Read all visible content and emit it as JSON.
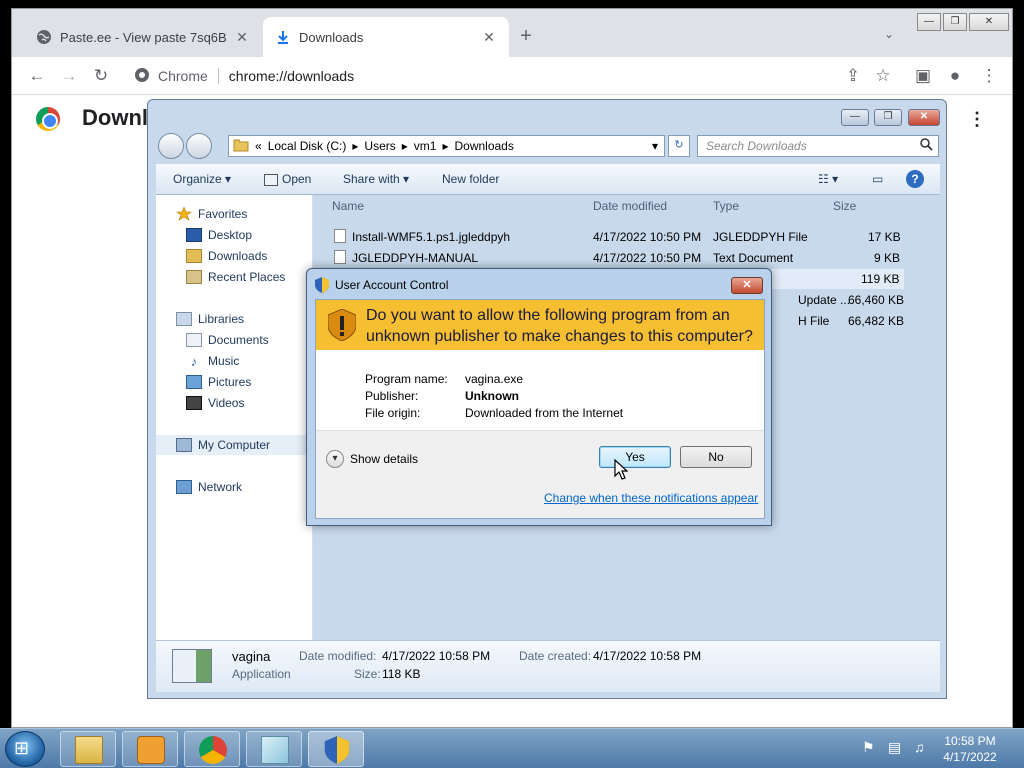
{
  "browser": {
    "tabs": [
      {
        "title": "Paste.ee - View paste 7sq6B",
        "close": "✕"
      },
      {
        "title": "Downloads",
        "close": "✕"
      }
    ],
    "new_tab": "+",
    "tab_search": "⌄",
    "window_controls": {
      "minimize": "—",
      "restore": "❐",
      "close": "✕"
    },
    "nav": {
      "back": "←",
      "forward": "→",
      "reload": "↻"
    },
    "omnibox": {
      "site_label": "Chrome",
      "url": "chrome://downloads"
    },
    "toolbar_icons": {
      "share": "⇪",
      "bookmark": "☆",
      "side_panel": "▣",
      "profile": "●",
      "menu": "⋮"
    },
    "page": {
      "title": "Downloads",
      "more": "⋮"
    }
  },
  "explorer": {
    "window_controls": {
      "minimize": "—",
      "restore": "❐",
      "close": "✕"
    },
    "address": {
      "prefix": "«",
      "parts": [
        "Local Disk (C:)",
        "Users",
        "vm1",
        "Downloads"
      ],
      "separator": "▸",
      "dropdown": "▾"
    },
    "refresh": "↻",
    "search_placeholder": "Search Downloads",
    "commands": {
      "organize": "Organize ▾",
      "open": "Open",
      "share_with": "Share with ▾",
      "new_folder": "New folder"
    },
    "nav_pane": {
      "favorites": "Favorites",
      "favorites_items": [
        "Desktop",
        "Downloads",
        "Recent Places"
      ],
      "libraries": "Libraries",
      "libraries_items": [
        "Documents",
        "Music",
        "Pictures",
        "Videos"
      ],
      "my_computer": "My Computer",
      "network": "Network"
    },
    "columns": [
      "Name",
      "Date modified",
      "Type",
      "Size"
    ],
    "files": [
      {
        "name": "Install-WMF5.1.ps1.jgleddpyh",
        "date": "4/17/2022 10:50 PM",
        "type": "JGLEDDPYH File",
        "size": "17 KB"
      },
      {
        "name": "JGLEDDPYH-MANUAL",
        "date": "4/17/2022 10:50 PM",
        "type": "Text Document",
        "size": "9 KB"
      },
      {
        "name": "",
        "date": "",
        "type": "",
        "size": "119 KB"
      },
      {
        "name": "",
        "date": "",
        "type": "Update ...",
        "size": "66,460 KB"
      },
      {
        "name": "",
        "date": "",
        "type": "H File",
        "size": "66,482 KB"
      }
    ],
    "details": {
      "name": "vagina",
      "kind": "Application",
      "modified_label": "Date modified:",
      "modified": "4/17/2022 10:58 PM",
      "created_label": "Date created:",
      "created": "4/17/2022 10:58 PM",
      "size_label": "Size:",
      "size": "118 KB"
    }
  },
  "uac": {
    "title": "User Account Control",
    "close": "✕",
    "question": "Do you want to allow the following program from an unknown publisher to make changes to this computer?",
    "program_label": "Program name:",
    "program": "vagina.exe",
    "publisher_label": "Publisher:",
    "publisher": "Unknown",
    "origin_label": "File origin:",
    "origin": "Downloaded from the Internet",
    "show_details": "Show details",
    "yes": "Yes",
    "no": "No",
    "link": "Change when these notifications appear"
  },
  "taskbar": {
    "time": "10:58 PM",
    "date": "4/17/2022"
  }
}
